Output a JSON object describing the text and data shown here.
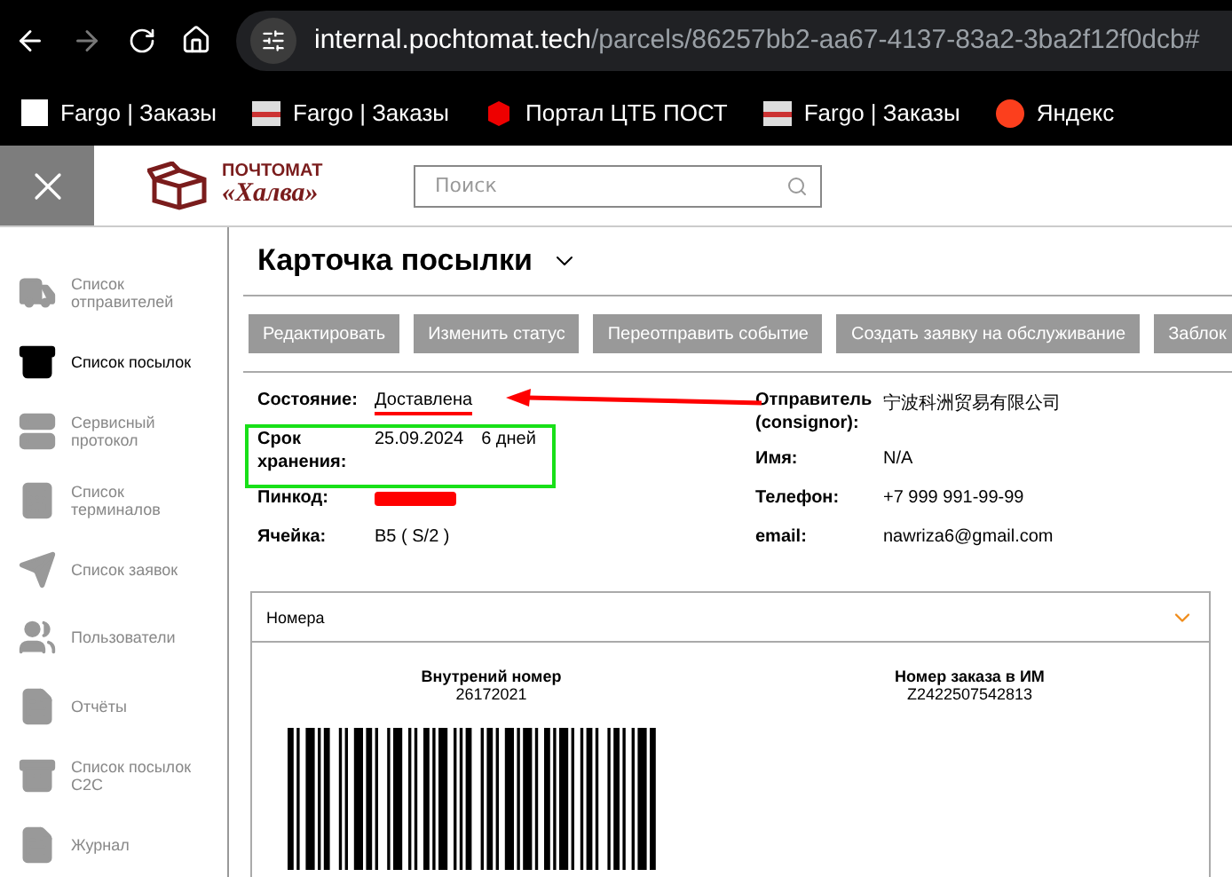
{
  "browser": {
    "url_host": "internal.pochtomat.tech",
    "url_path": "/parcels/86257bb2-aa67-4137-83a2-3ba2f12f0dcb#",
    "bookmarks": [
      {
        "label": "Fargo | Заказы",
        "kind": "blank"
      },
      {
        "label": "Fargo | Заказы",
        "kind": "fargo"
      },
      {
        "label": "Портал ЦТБ ПОСТ",
        "kind": "box"
      },
      {
        "label": "Fargo | Заказы",
        "kind": "fargo"
      },
      {
        "label": "Яндекс",
        "kind": "yandex"
      }
    ]
  },
  "header": {
    "logo_top": "ПОЧТОМАТ",
    "logo_bottom": "«Халва»",
    "search": {
      "placeholder": "Поиск"
    }
  },
  "sidebar": {
    "items": [
      {
        "label": "Список отправителей",
        "selected": false
      },
      {
        "label": "Список посылок",
        "selected": true
      },
      {
        "label": "Сервисный протокол",
        "selected": false
      },
      {
        "label": "Список терминалов",
        "selected": false
      },
      {
        "label": "Список заявок",
        "selected": false
      },
      {
        "label": "Пользователи",
        "selected": false
      },
      {
        "label": "Отчёты",
        "selected": false
      },
      {
        "label": "Список посылок C2C",
        "selected": false
      },
      {
        "label": "Журнал",
        "selected": false
      }
    ]
  },
  "card": {
    "title": "Карточка посылки",
    "buttons": [
      "Редактировать",
      "Изменить статус",
      "Переотправить событие",
      "Создать заявку на обслуживание",
      "Заблок"
    ],
    "left_fields": [
      {
        "label": "Состояние:",
        "value": "Доставлена",
        "kind": "underlined"
      },
      {
        "label": "Срок хранения:",
        "value": "25.09.2024",
        "extra": "6 дней",
        "kind": "boxed"
      },
      {
        "label": "Пинкод:",
        "kind": "redacted"
      },
      {
        "label": "Ячейка:",
        "value": "B5 ( S/2 )",
        "kind": "plain"
      }
    ],
    "right_fields": [
      {
        "label": "Отправитель (consignor):",
        "value": "宁波科洲贸易有限公司"
      },
      {
        "label": "Имя:",
        "value": "N/A"
      },
      {
        "label": "Телефон:",
        "value": "+7 999 991-99-99"
      },
      {
        "label": "email:",
        "value": "nawriza6@gmail.com"
      }
    ],
    "panel": {
      "title": "Номера",
      "expanded": true,
      "numbers": [
        {
          "label": "Внутрений номер",
          "value": "26172021"
        },
        {
          "label": "Номер заказа в ИМ",
          "value": "Z2422507542813"
        }
      ]
    }
  }
}
